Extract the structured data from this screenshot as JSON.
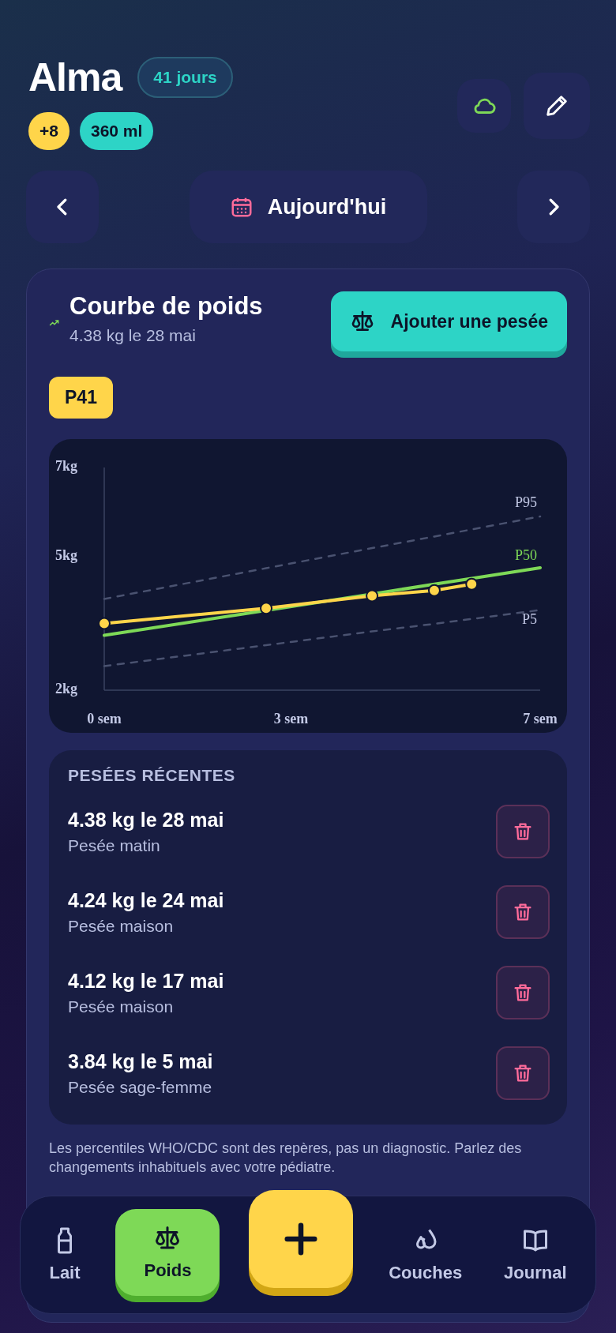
{
  "header": {
    "name": "Alma",
    "age_badge": "41 jours",
    "chips": [
      {
        "label": "+8",
        "color": "#ffd54a"
      },
      {
        "label": "360 ml",
        "color": "#2dd4c6"
      }
    ]
  },
  "date_nav": {
    "label": "Aujourd'hui"
  },
  "weight_card": {
    "title": "Courbe de poids",
    "subtitle": "4.38 kg le 28 mai",
    "add_button": "Ajouter une pesée",
    "percentile_badge": "P41",
    "chart_data": {
      "type": "line",
      "x": [
        0,
        2.6,
        4.3,
        5.3,
        5.9,
        7
      ],
      "xlim": [
        0,
        7
      ],
      "ylim": [
        2,
        7
      ],
      "xticks": [
        {
          "value": 0,
          "label": "0 sem"
        },
        {
          "value": 3,
          "label": "3 sem"
        },
        {
          "value": 7,
          "label": "7 sem"
        }
      ],
      "yticks": [
        {
          "value": 2,
          "label": "2kg"
        },
        {
          "value": 5,
          "label": "5kg"
        },
        {
          "value": 7,
          "label": "7kg"
        }
      ],
      "series": [
        {
          "name": "P95",
          "color": "#4a5270",
          "line_style": "dashed",
          "values": [
            4.05,
            4.74,
            5.19,
            5.45,
            5.61,
            5.9
          ]
        },
        {
          "name": "P50",
          "color": "#7ed957",
          "line_style": "solid",
          "values": [
            3.23,
            3.79,
            4.16,
            4.38,
            4.51,
            4.75
          ]
        },
        {
          "name": "P5",
          "color": "#4a5270",
          "line_style": "dashed",
          "values": [
            2.54,
            3.01,
            3.32,
            3.49,
            3.6,
            3.8
          ]
        },
        {
          "color": "#ffd54a",
          "line_style": "solid",
          "marker": "circle",
          "values": [
            3.5,
            3.84,
            4.12,
            4.24,
            4.38,
            null
          ]
        }
      ]
    },
    "recent": {
      "heading": "PESÉES RÉCENTES",
      "items": [
        {
          "weight": "4.38 kg le 28 mai",
          "note": "Pesée matin"
        },
        {
          "weight": "4.24 kg le 24 mai",
          "note": "Pesée maison"
        },
        {
          "weight": "4.12 kg le 17 mai",
          "note": "Pesée maison"
        },
        {
          "weight": "3.84 kg le 5 mai",
          "note": "Pesée sage-femme"
        }
      ]
    },
    "disclaimer": "Les percentiles WHO/CDC sont des repères, pas un diagnostic. Parlez des changements inhabituels avec votre pédiatre."
  },
  "bottom_nav": [
    {
      "kind": "tab",
      "label": "Lait",
      "selected": false
    },
    {
      "kind": "tab",
      "label": "Poids",
      "selected": true
    },
    {
      "kind": "fab"
    },
    {
      "kind": "tab",
      "label": "Couches",
      "selected": false
    },
    {
      "kind": "tab",
      "label": "Journal",
      "selected": false
    }
  ]
}
